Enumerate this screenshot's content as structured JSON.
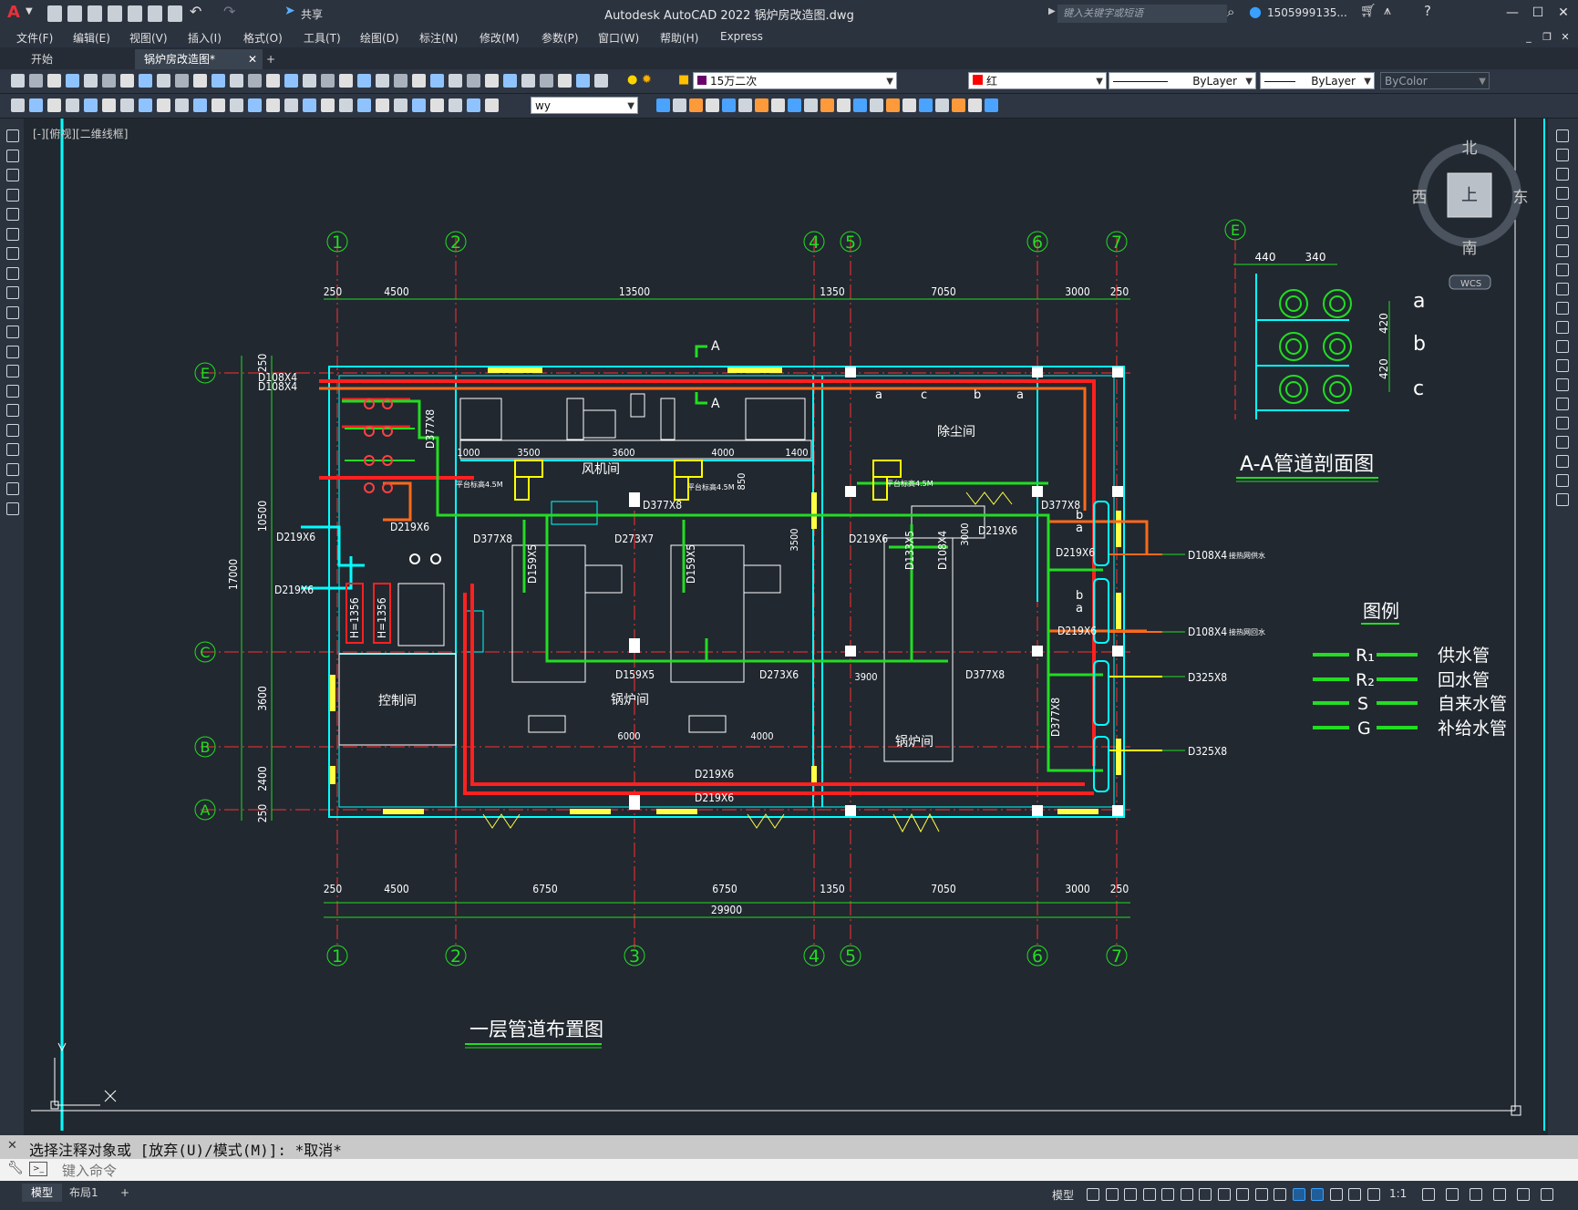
{
  "app": {
    "title": "Autodesk AutoCAD 2022    锅炉房改造图.dwg",
    "share_label": "共享",
    "search_placeholder": "键入关键字或短语",
    "user_label": "1505999135...",
    "logo": "A"
  },
  "menu": [
    "文件(F)",
    "编辑(E)",
    "视图(V)",
    "插入(I)",
    "格式(O)",
    "工具(T)",
    "绘图(D)",
    "标注(N)",
    "修改(M)",
    "参数(P)",
    "窗口(W)",
    "帮助(H)",
    "Express"
  ],
  "tabs": {
    "start": "开始",
    "active": "锅炉房改造图*",
    "add": "+"
  },
  "toolbar": {
    "layer": "15万二次",
    "color": "红",
    "color_swatch": "#ff0000",
    "linetype": "ByLayer",
    "lineweight": "ByLayer",
    "plotstyle": "ByColor",
    "textstyle": "wy"
  },
  "viewport": {
    "label": "[-][俯视][二维线框]",
    "compass": {
      "north": "北",
      "south": "南",
      "east": "东",
      "west": "西",
      "top": "上",
      "wcs": "WCS"
    }
  },
  "colors": {
    "cyan": "#00ffff",
    "red": "#ff2020",
    "orange": "#ff6a1a",
    "green": "#22dd22",
    "yellow": "#ffff00",
    "white": "#ffffff",
    "grid": "#ff3030"
  },
  "drawing": {
    "plan_title": "一层管道布置图",
    "section_title": "A-A管道剖面图",
    "legend_title": "图例",
    "legend": [
      {
        "code": "R₁",
        "label": "供水管"
      },
      {
        "code": "R₂",
        "label": "回水管"
      },
      {
        "code": "S",
        "label": "自来水管"
      },
      {
        "code": "G",
        "label": "补给水管"
      }
    ],
    "axes_top": [
      "1",
      "2",
      "4",
      "5",
      "6",
      "7"
    ],
    "axes_bottom": [
      "1",
      "2",
      "3",
      "4",
      "5",
      "6",
      "7"
    ],
    "axes_left": [
      "E",
      "C",
      "B",
      "A"
    ],
    "dims_top": [
      "250",
      "4500",
      "13500",
      "1350",
      "7050",
      "3000",
      "250"
    ],
    "dims_bottom": [
      "250",
      "4500",
      "6750",
      "6750",
      "1350",
      "7050",
      "3000",
      "250"
    ],
    "dim_total": "29900",
    "dims_left": [
      "250",
      "10500",
      "3600",
      "2400",
      "250"
    ],
    "dim_left_total": "17000",
    "rooms": {
      "fan": "风机间",
      "dust": "除尘间",
      "boiler1": "锅炉间",
      "boiler2": "锅炉间",
      "control": "控制间"
    },
    "pipe_labels": {
      "d108_1": "D108X4",
      "d108_2": "D108X4",
      "d219_1": "D219X6",
      "d219_2": "D219X6",
      "d219_3": "D219X6",
      "d219_4": "D219X6",
      "d219_5": "D219X6",
      "d219_6": "D219X6",
      "d219_7": "D219X6",
      "d219_8": "D219X6",
      "d219_9": "D219X6",
      "d377_1": "D377X8",
      "d377_2": "D377X8",
      "d377_3": "D377X8",
      "d377_4": "D377X8",
      "d377_5": "D377X8",
      "d377_6": "D377X8",
      "d273_1": "D273X7",
      "d273_2": "D273X6",
      "d159_1": "D159X5",
      "d159_2": "D159X5",
      "d159_3": "D159X5",
      "d133": "D133X5",
      "d108v": "D108X4",
      "h1": "H=1356",
      "h2": "H=1356",
      "out1": "D108X4",
      "out2": "D108X4",
      "out3": "D325X8",
      "out4": "D325X8",
      "out1_note": "接热网供水",
      "out2_note": "接热网回水",
      "sec_a": "A",
      "sec_a2": "A"
    },
    "inner_dims": [
      "1000",
      "3500",
      "3600",
      "4000",
      "1400",
      "850",
      "3500",
      "3000",
      "6000",
      "4000",
      "3900"
    ],
    "fan_notes": [
      "平台标高4.5M",
      "平台标高4.5M",
      "平台标高4.5M"
    ],
    "section": {
      "axis": "E",
      "dims": [
        "440",
        "340"
      ],
      "vdims": [
        "420",
        "420"
      ],
      "rows": [
        "a",
        "b",
        "c"
      ],
      "pipe_marks": [
        "a",
        "c",
        "b",
        "a"
      ],
      "riser_marks": [
        "b",
        "a",
        "b",
        "a"
      ]
    }
  },
  "command": {
    "history": "选择注释对象或 [放弃(U)/模式(M)]: *取消*",
    "placeholder": "键入命令"
  },
  "status": {
    "model": "模型",
    "layout1": "布局1",
    "model_btn": "模型",
    "scale": "1:1"
  }
}
